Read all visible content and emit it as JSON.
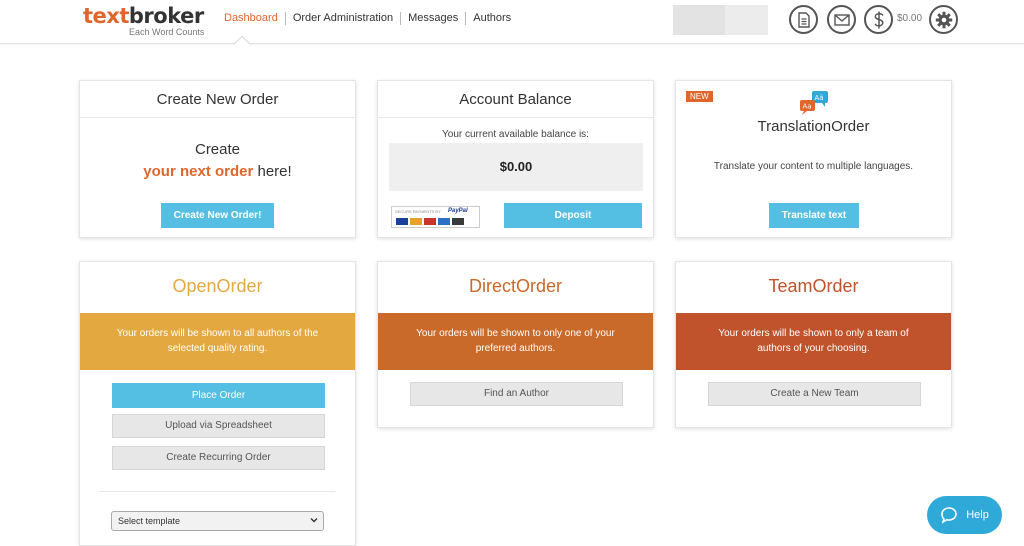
{
  "header": {
    "logo": {
      "part1": "text",
      "part2": "broker",
      "tagline": "Each Word Counts"
    },
    "nav": [
      "Dashboard",
      "Order Administration",
      "Messages",
      "Authors"
    ],
    "active_nav": "Dashboard",
    "balance": "$0.00",
    "icons": [
      "document-icon",
      "mail-icon",
      "dollar-icon",
      "gear-icon"
    ]
  },
  "cards": {
    "create_order": {
      "title": "Create New Order",
      "line1": "Create",
      "highlight": "your next order",
      "line2_rest": " here!",
      "button": "Create New Order!"
    },
    "account_balance": {
      "title": "Account Balance",
      "subtitle": "Your current available balance is:",
      "amount": "$0.00",
      "paypal_label": "SECURE PAYMENTS BY",
      "paypal_brand": "PayPal",
      "button": "Deposit"
    },
    "translation": {
      "badge": "NEW",
      "title": "TranslationOrder",
      "description": "Translate your content to multiple languages.",
      "button": "Translate text"
    },
    "open_order": {
      "title": "OpenOrder",
      "description": "Your orders will be shown to all authors of the selected quality rating.",
      "primary_button": "Place Order",
      "button2": "Upload via Spreadsheet",
      "button3": "Create Recurring Order",
      "select_value": "Select template"
    },
    "direct_order": {
      "title": "DirectOrder",
      "description": "Your orders will be shown to only one of your preferred authors.",
      "button": "Find an Author"
    },
    "team_order": {
      "title": "TeamOrder",
      "description": "Your orders will be shown to only a team of authors of your choosing.",
      "button": "Create a New Team"
    }
  },
  "help": {
    "label": "Help"
  },
  "colors": {
    "brand_orange": "#e0662c",
    "open_yellow": "#e3a840",
    "direct_orange": "#c9692a",
    "team_red": "#c0532b",
    "button_blue": "#55bfe3",
    "help_blue": "#2fa9d8"
  }
}
